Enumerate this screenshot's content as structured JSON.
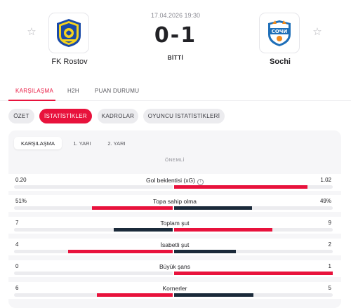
{
  "match": {
    "datetime": "17.04.2026 19:30",
    "score": "0-1",
    "status": "BİTTİ",
    "home": {
      "name": "FK Rostov",
      "logo_text": "FK ROSTOV",
      "color": "#1a4aa8",
      "accent": "#f5d21e"
    },
    "away": {
      "name": "Sochi",
      "logo_text": "Сочи",
      "color": "#1f6fb8",
      "accent": "#f28a1c"
    }
  },
  "icons": {
    "favorite": "star-outline-icon",
    "info": "info-icon"
  },
  "main_tabs": [
    {
      "label": "KARŞILAŞMA",
      "active": true
    },
    {
      "label": "H2H",
      "active": false
    },
    {
      "label": "PUAN DURUMU",
      "active": false
    }
  ],
  "sub_tabs": [
    {
      "label": "ÖZET",
      "active": false
    },
    {
      "label": "İSTATİSTİKLER",
      "active": true
    },
    {
      "label": "KADROLAR",
      "active": false
    },
    {
      "label": "OYUNCU İSTATİSTİKLERİ",
      "active": false
    }
  ],
  "period_tabs": [
    {
      "label": "KARŞILAŞMA",
      "active": true
    },
    {
      "label": "1. YARI",
      "active": false
    },
    {
      "label": "2. YARI",
      "active": false
    }
  ],
  "section_title": "ÖNEMLİ",
  "colors": {
    "accent": "#e8123c",
    "dark": "#1b2a3a",
    "track": "#ececef"
  },
  "stats": [
    {
      "label": "Gol beklentisi (xG)",
      "home": "0.20",
      "away": "1.02",
      "info": true,
      "home_share": 0.0,
      "away_share": 0.84,
      "home_color": "dark",
      "away_color": "accent"
    },
    {
      "label": "Topa sahip olma",
      "home": "51%",
      "away": "49%",
      "info": false,
      "home_share": 0.51,
      "away_share": 0.49,
      "home_color": "accent",
      "away_color": "dark"
    },
    {
      "label": "Toplam şut",
      "home": "7",
      "away": "9",
      "info": false,
      "home_share": 0.37,
      "away_share": 0.62,
      "home_color": "dark",
      "away_color": "accent"
    },
    {
      "label": "İsabetli şut",
      "home": "4",
      "away": "2",
      "info": false,
      "home_share": 0.66,
      "away_share": 0.39,
      "home_color": "accent",
      "away_color": "dark"
    },
    {
      "label": "Büyük şans",
      "home": "0",
      "away": "1",
      "info": false,
      "home_share": 0.0,
      "away_share": 1.0,
      "home_color": "dark",
      "away_color": "accent"
    },
    {
      "label": "Kornerler",
      "home": "6",
      "away": "5",
      "info": false,
      "home_share": 0.48,
      "away_share": 0.5,
      "home_color": "accent",
      "away_color": "dark"
    }
  ]
}
